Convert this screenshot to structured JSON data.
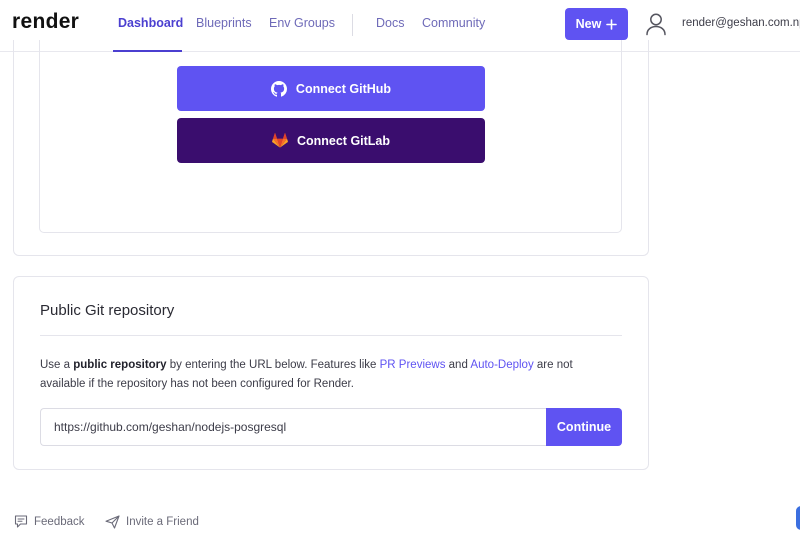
{
  "brand": {
    "logo": "render"
  },
  "nav": {
    "items": [
      {
        "label": "Dashboard"
      },
      {
        "label": "Blueprints"
      },
      {
        "label": "Env Groups"
      },
      {
        "label": "Docs"
      },
      {
        "label": "Community"
      }
    ],
    "new_button": "New",
    "user_email": "render@geshan.com.np"
  },
  "connect": {
    "github_label": "Connect GitHub",
    "gitlab_label": "Connect GitLab"
  },
  "public_repo": {
    "title": "Public Git repository",
    "desc_1": "Use a ",
    "desc_bold": "public repository",
    "desc_2": " by entering the URL below. Features like ",
    "link_pr": "PR Previews",
    "desc_3": " and ",
    "link_autodeploy": "Auto-Deploy",
    "desc_4": " are not available if the repository has not been configured for Render.",
    "url_value": "https://github.com/geshan/nodejs-posgresql",
    "continue_label": "Continue"
  },
  "footer": {
    "feedback": "Feedback",
    "invite": "Invite a Friend"
  },
  "colors": {
    "accent": "#5f53f2",
    "gitlab_bg": "#3a0d6e",
    "nav_active": "#4b3fd0"
  }
}
